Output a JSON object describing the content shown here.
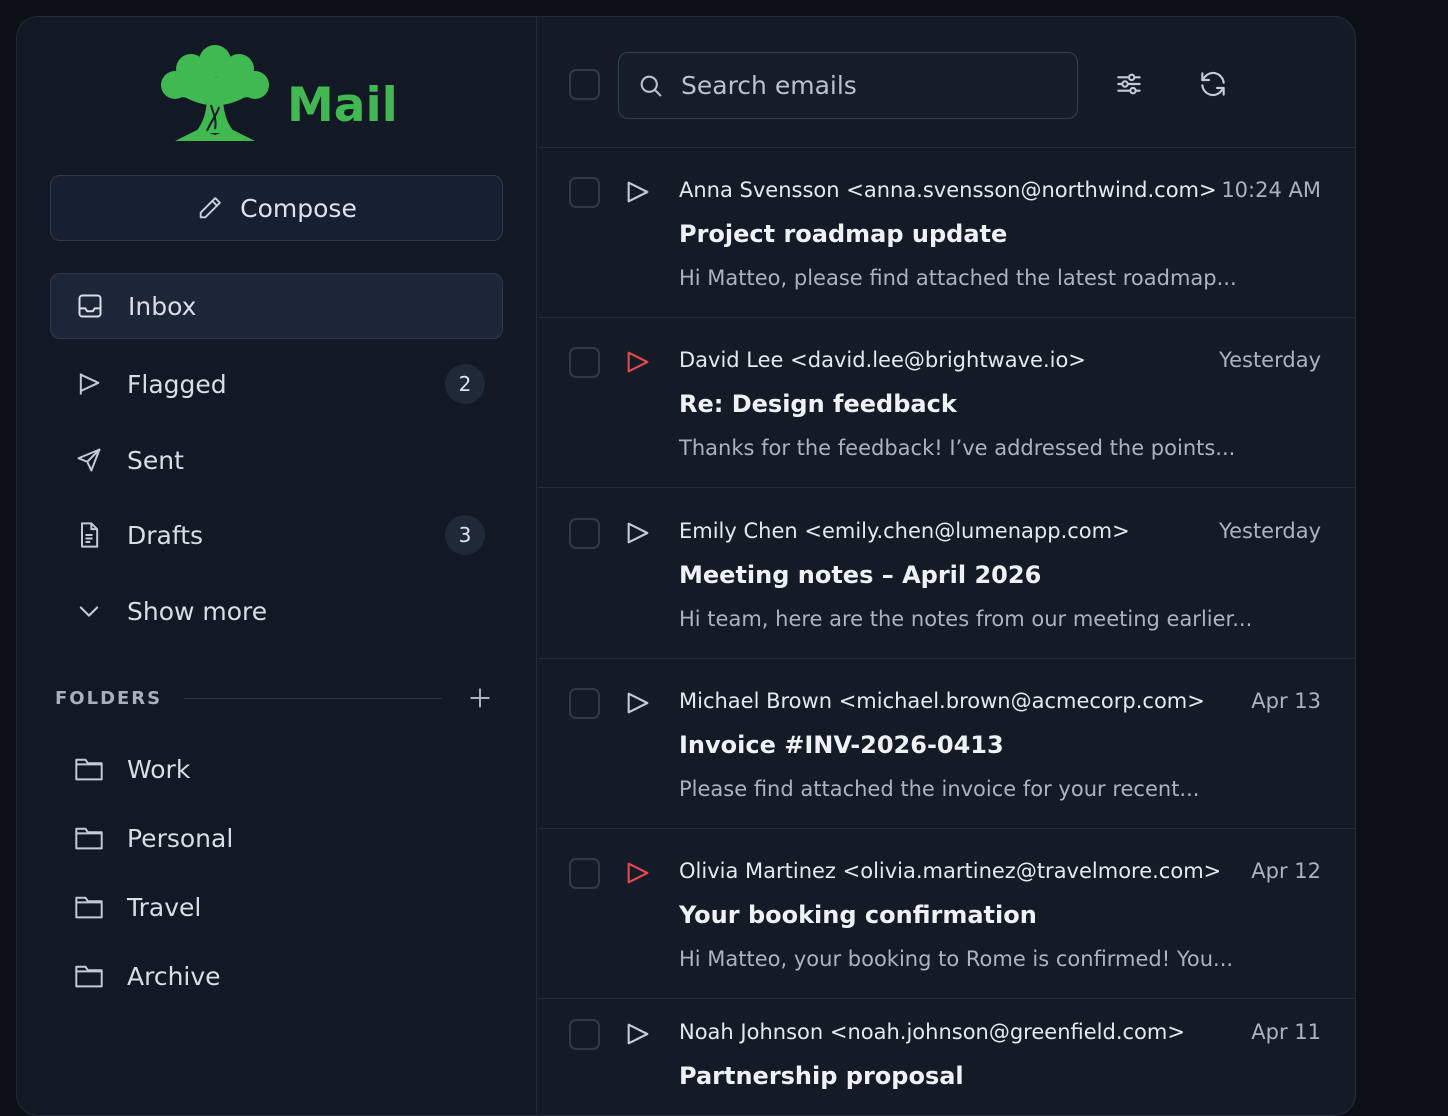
{
  "app": {
    "name": "Mail"
  },
  "compose": {
    "label": "Compose"
  },
  "nav": [
    {
      "label": "Inbox",
      "icon": "inbox-icon",
      "badge": ""
    },
    {
      "label": "Flagged",
      "icon": "flag-icon",
      "badge": "2"
    },
    {
      "label": "Sent",
      "icon": "send-icon",
      "badge": ""
    },
    {
      "label": "Drafts",
      "icon": "file-text-icon",
      "badge": "3"
    },
    {
      "label": "Show more",
      "icon": "chevron-down-icon",
      "badge": ""
    }
  ],
  "folders": {
    "heading": "FOLDERS",
    "items": [
      "Work",
      "Personal",
      "Travel",
      "Archive"
    ]
  },
  "search": {
    "placeholder": "Search emails",
    "value": ""
  },
  "colors": {
    "brand": "#3fb950",
    "flag_active": "#e5484d",
    "background": "#141b26"
  },
  "emails": [
    {
      "sender": "Anna Svensson <anna.svensson@northwind.com>",
      "time": "10:24 AM",
      "subject": "Project roadmap update",
      "preview": "Hi Matteo, please find attached the latest roadmap...",
      "flagged": false
    },
    {
      "sender": "David Lee <david.lee@brightwave.io>",
      "time": "Yesterday",
      "subject": "Re: Design feedback",
      "preview": "Thanks for the feedback! I’ve addressed the points...",
      "flagged": true
    },
    {
      "sender": "Emily Chen <emily.chen@lumenapp.com>",
      "time": "Yesterday",
      "subject": "Meeting notes – April 2026",
      "preview": "Hi team, here are the notes from our meeting earlier...",
      "flagged": false
    },
    {
      "sender": "Michael Brown <michael.brown@acmecorp.com>",
      "time": "Apr 13",
      "subject": "Invoice #INV-2026-0413",
      "preview": "Please find attached the invoice for your recent...",
      "flagged": false
    },
    {
      "sender": "Olivia Martinez <olivia.martinez@travelmore.com>",
      "time": "Apr 12",
      "subject": "Your booking confirmation",
      "preview": "Hi Matteo, your booking to Rome is confirmed! You...",
      "flagged": true
    },
    {
      "sender": "Noah Johnson <noah.johnson@greenfield.com>",
      "time": "Apr 11",
      "subject": "Partnership proposal",
      "preview": "",
      "flagged": false
    }
  ]
}
